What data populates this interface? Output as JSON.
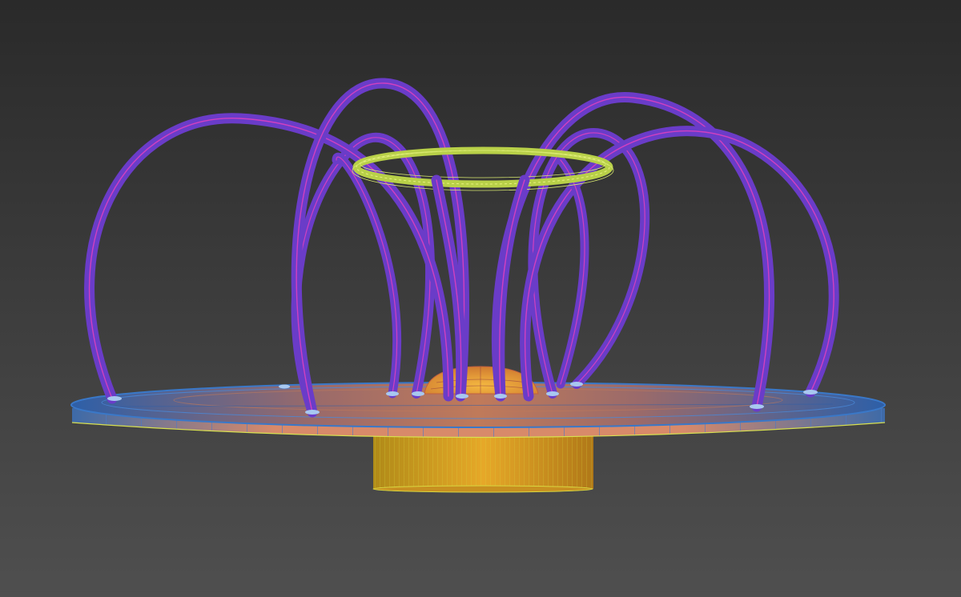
{
  "viewport": {
    "label": "",
    "background_top": "#2c2c2c",
    "background_bottom": "#4d4d4d"
  },
  "scene": {
    "objects": [
      {
        "name": "ground-disc",
        "kind": "cylinder",
        "color": "#d98a66",
        "wire_color": "#3a78c8"
      },
      {
        "name": "base-pedestal",
        "kind": "cylinder",
        "color": "#e0a020",
        "wire_color": "#d8e040"
      },
      {
        "name": "center-dome",
        "kind": "hemisphere",
        "color": "#f0a030",
        "wire_color": "#c06040"
      },
      {
        "name": "top-ring",
        "kind": "torus",
        "color": "#c8e060",
        "wire_color": "#e8f080"
      },
      {
        "name": "arch-tubes",
        "kind": "tube",
        "count": 8,
        "color": "#6a3cc8",
        "wire_color": "#d040c0"
      }
    ]
  }
}
